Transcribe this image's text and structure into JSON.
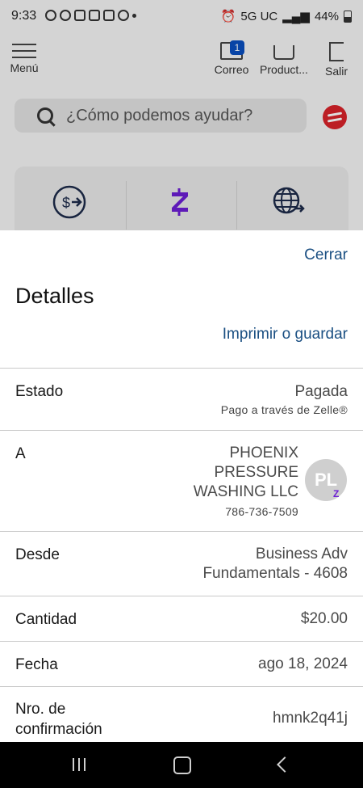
{
  "status_bar": {
    "time": "9:33",
    "network": "5G UC",
    "battery": "44%",
    "battery_level": 0.44
  },
  "top_nav": {
    "menu_label": "Menú",
    "mail_label": "Correo",
    "mail_badge": "1",
    "products_label": "Product...",
    "exit_label": "Salir"
  },
  "search": {
    "placeholder": "¿Cómo podemos ayudar?"
  },
  "colors": {
    "link": "#1a4f82",
    "brand_red": "#d8232a",
    "zelle_purple": "#6d1ed4",
    "badge_blue": "#0a4fbf"
  },
  "details": {
    "close_label": "Cerrar",
    "title": "Detalles",
    "print_label": "Imprimir o guardar",
    "rows": [
      {
        "label": "Estado",
        "value": "Pagada",
        "sub": "Pago a través de Zelle®"
      },
      {
        "label": "A",
        "value_lines": [
          "PHOENIX",
          "PRESSURE",
          "WASHING LLC"
        ],
        "sub": "786-736-7509",
        "avatar_initials": "PL"
      },
      {
        "label": "Desde",
        "value_lines": [
          "Business Adv",
          "Fundamentals - 4608"
        ]
      },
      {
        "label": "Cantidad",
        "value": "$20.00"
      },
      {
        "label": "Fecha",
        "value": "ago 18, 2024"
      },
      {
        "label_lines": [
          "Nro. de",
          "confirmación"
        ],
        "value": "hmnk2q41j"
      }
    ]
  }
}
